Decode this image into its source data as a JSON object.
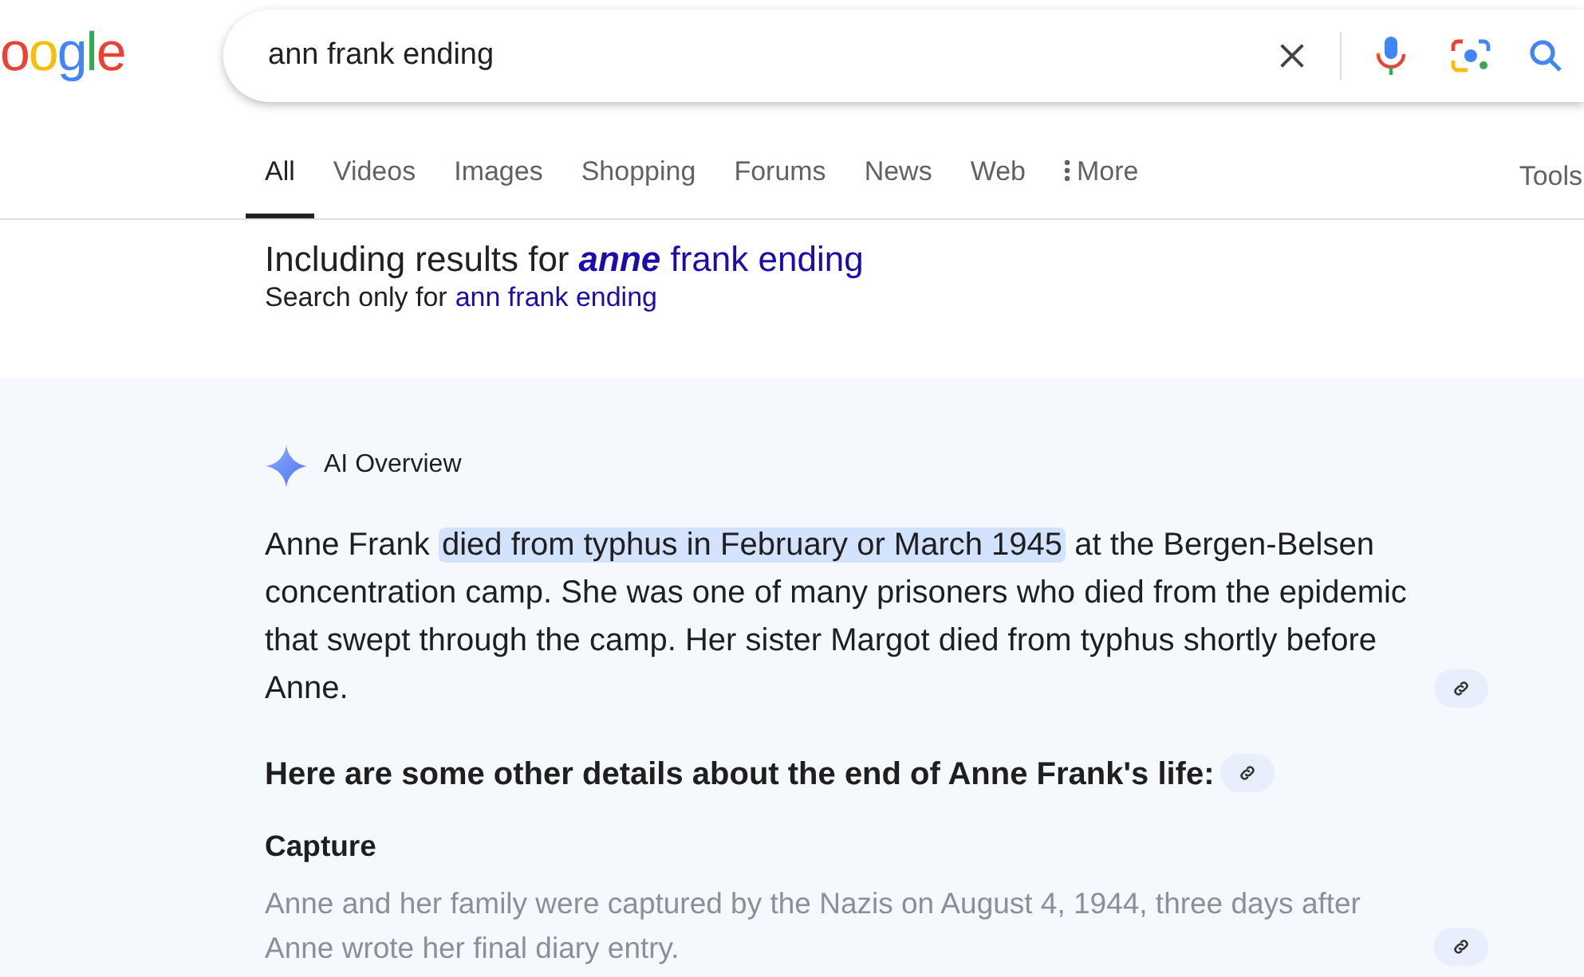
{
  "logo": {
    "text": "oogle"
  },
  "search": {
    "value": "ann frank ending"
  },
  "tabs": [
    {
      "label": "All",
      "selected": true
    },
    {
      "label": "Videos",
      "selected": false
    },
    {
      "label": "Images",
      "selected": false
    },
    {
      "label": "Shopping",
      "selected": false
    },
    {
      "label": "Forums",
      "selected": false
    },
    {
      "label": "News",
      "selected": false
    },
    {
      "label": "Web",
      "selected": false
    },
    {
      "label": "More",
      "selected": false,
      "kind": "menu"
    }
  ],
  "tools": "Tools",
  "correction": {
    "prefix": "Including results for",
    "emphasized": "anne",
    "rest": "frank ending",
    "only_prefix": "Search only for",
    "only_link": "ann frank ending"
  },
  "ai_overview": {
    "title": "AI Overview",
    "summary": [
      {
        "text": "Anne Frank ",
        "highlighted": false
      },
      {
        "text": "died from typhus in February or March 1945",
        "highlighted": true
      },
      {
        "text": " at the Bergen-Belsen concentration camp. She was one of many prisoners who died from the epidemic that swept through the camp. Her sister Margot died from typhus shortly before Anne.",
        "highlighted": false
      }
    ],
    "heading": "Here are some other details about the end of Anne Frank's life:",
    "sections": [
      {
        "title": "Capture",
        "text": "Anne and her family were captured by the Nazis on August 4, 1944, three days after Anne wrote her final diary entry."
      }
    ]
  }
}
